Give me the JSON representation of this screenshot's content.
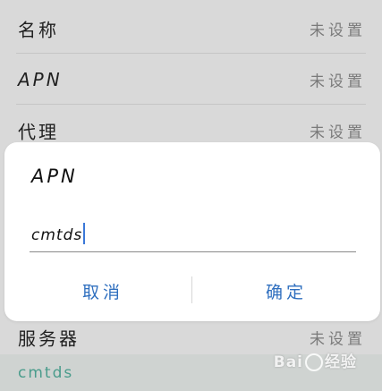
{
  "settings": {
    "rows": [
      {
        "label": "名称",
        "value": "未设置"
      },
      {
        "label": "APN",
        "value": "未设置"
      },
      {
        "label": "代理",
        "value": "未设置"
      },
      {
        "label": "服务器",
        "value": "未设置"
      }
    ],
    "highlighted_row_label": "cmtds"
  },
  "dialog": {
    "title": "APN",
    "input_value": "cmtds",
    "cancel_label": "取消",
    "ok_label": "确定"
  },
  "watermark": {
    "text_left": "Bai",
    "text_right": "经验"
  }
}
